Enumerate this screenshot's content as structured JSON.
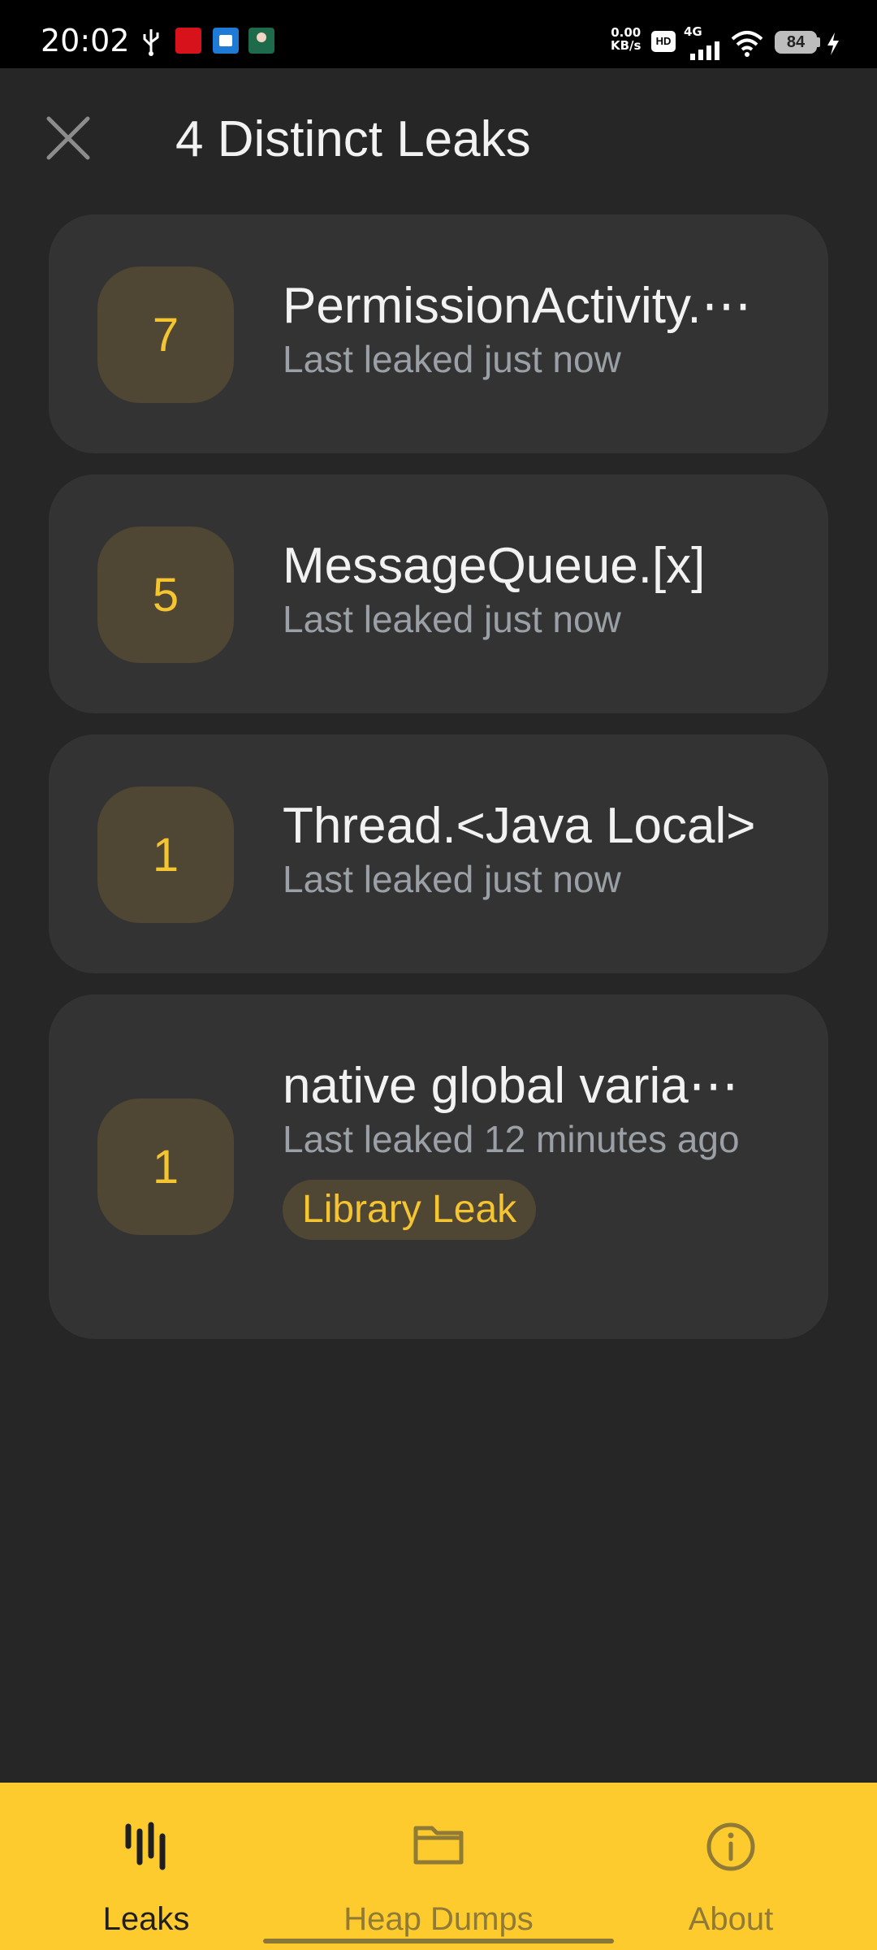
{
  "status_bar": {
    "time": "20:02",
    "net_speed_value": "0.00",
    "net_speed_unit": "KB/s",
    "hd_label": "HD",
    "network_type": "4G",
    "battery_level": "84",
    "icons": [
      "usb-icon",
      "app-notification-icon",
      "app-notification-icon",
      "app-notification-icon",
      "hd-icon",
      "signal-icon",
      "wifi-icon",
      "battery-icon",
      "charging-icon"
    ]
  },
  "header": {
    "close_icon": "close-icon",
    "title": "4 Distinct Leaks"
  },
  "leaks": [
    {
      "count": "7",
      "title": "PermissionActivity.⋯",
      "subtitle": "Last leaked just now",
      "tag": ""
    },
    {
      "count": "5",
      "title": "MessageQueue.[x]",
      "subtitle": "Last leaked just now",
      "tag": ""
    },
    {
      "count": "1",
      "title": "Thread.<Java Local>",
      "subtitle": "Last leaked just now",
      "tag": ""
    },
    {
      "count": "1",
      "title": "native global varia⋯",
      "subtitle": "Last leaked 12 minutes ago",
      "tag": "Library Leak"
    }
  ],
  "bottom_nav": {
    "items": [
      {
        "label": "Leaks",
        "icon": "leaks-icon",
        "active": true
      },
      {
        "label": "Heap Dumps",
        "icon": "folder-icon",
        "active": false
      },
      {
        "label": "About",
        "icon": "info-icon",
        "active": false
      }
    ]
  },
  "colors": {
    "background": "#262626",
    "card": "#333333",
    "accent": "#fecb2f",
    "badge_bg": "#4f4633",
    "badge_text": "#f4c431"
  }
}
